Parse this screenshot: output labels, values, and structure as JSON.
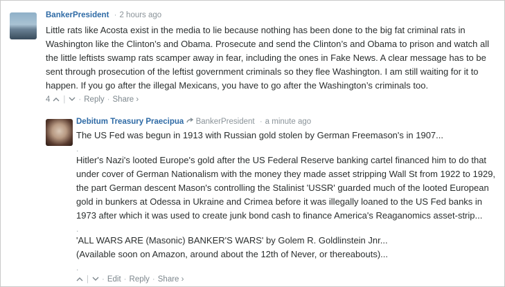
{
  "comments": [
    {
      "author": "BankerPresident",
      "time": "2 hours ago",
      "text": "Little rats like Acosta exist in the media to lie because nothing has been done to the big fat criminal rats in Washington like the Clinton’s and Obama. Prosecute and send the Clinton’s and Obama to prison and watch all the little leftists swamp rats scamper away in fear, including the ones in Fake News. A clear message has to be sent through prosecution of the leftist government criminals so they flee Washington. I am still waiting for it to happen. If you go after the illegal Mexicans, you have to go after the Washington’s criminals too.",
      "votes": "4",
      "actions": {
        "reply": "Reply",
        "share": "Share ›"
      }
    },
    {
      "author": "Debitum Treasury Praecipua",
      "reply_to": "BankerPresident",
      "time": "a minute ago",
      "paragraphs": [
        "The US Fed was begun in 1913 with Russian gold stolen by German Freemason's in 1907...",
        ".",
        "Hitler's Nazi's looted Europe's gold after the US Federal Reserve banking cartel financed him to do that under cover of German Nationalism with the money they made asset stripping Wall St from 1922 to 1929, the part German descent Mason's controlling the Stalinist 'USSR' guarded much of the looted European gold in bunkers at Odessa in Ukraine and Crimea before it was illegally loaned to the US Fed banks in 1973 after which it was used to create junk bond cash to finance America's Reaganomics asset-strip...",
        ".",
        "'ALL WARS ARE (Masonic) BANKER'S WARS' by Golem R. Goldlinstein Jnr...",
        "(Available soon on Amazon, around about the 12th of Never, or thereabouts)...",
        "."
      ],
      "actions": {
        "edit": "Edit",
        "reply": "Reply",
        "share": "Share ›"
      }
    }
  ],
  "icons": {
    "upvote": "chevron-up-icon",
    "downvote": "chevron-down-icon",
    "reply_arrow": "reply-arrow-icon"
  }
}
